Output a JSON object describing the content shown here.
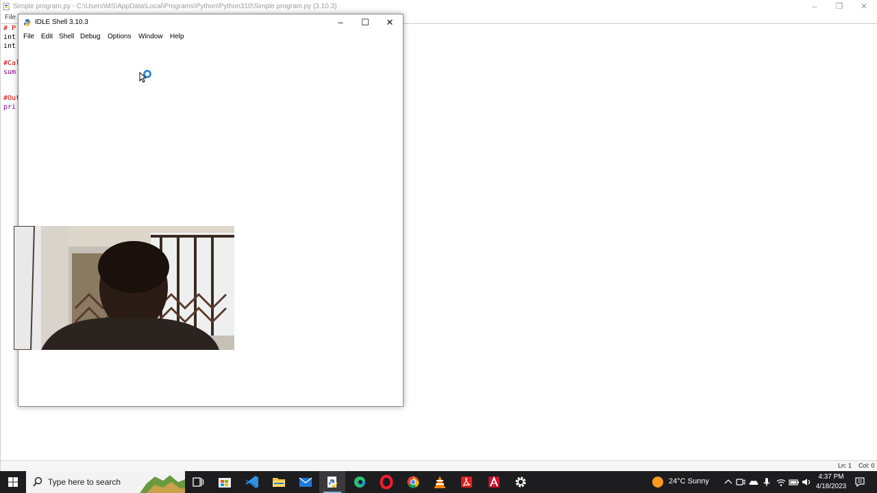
{
  "editor": {
    "title": "Simple program.py - C:\\Users\\MS\\AppData\\Local\\Programs\\Python\\Python310\\Simple program.py (3.10.3)",
    "menu_file": "File",
    "code_lines": [
      {
        "text": "# P",
        "cls": "c-comment"
      },
      {
        "text": "int",
        "cls": "c-plain"
      },
      {
        "text": "int",
        "cls": "c-plain"
      },
      {
        "text": "",
        "cls": "c-plain"
      },
      {
        "text": "#Cal",
        "cls": "c-comment"
      },
      {
        "text": "sum",
        "cls": "c-kw"
      },
      {
        "text": "",
        "cls": "c-plain"
      },
      {
        "text": "",
        "cls": "c-plain"
      },
      {
        "text": "#Out",
        "cls": "c-comment"
      },
      {
        "text": "pri",
        "cls": "c-kw"
      }
    ],
    "status_ln": "Ln: 1",
    "status_col": "Col: 0"
  },
  "shell": {
    "title": "IDLE Shell 3.10.3",
    "menu": [
      "File",
      "Edit",
      "Shell",
      "Debug",
      "Options",
      "Window",
      "Help"
    ]
  },
  "taskbar": {
    "search_placeholder": "Type here to search",
    "weather": "24°C  Sunny",
    "time": "4:37 PM",
    "date": "4/18/2023"
  },
  "colors": {
    "taskbar_bg": "#1d1d1f",
    "accent": "#2d89d9",
    "comment_red": "#dd0000",
    "keyword_purple": "#900090"
  }
}
